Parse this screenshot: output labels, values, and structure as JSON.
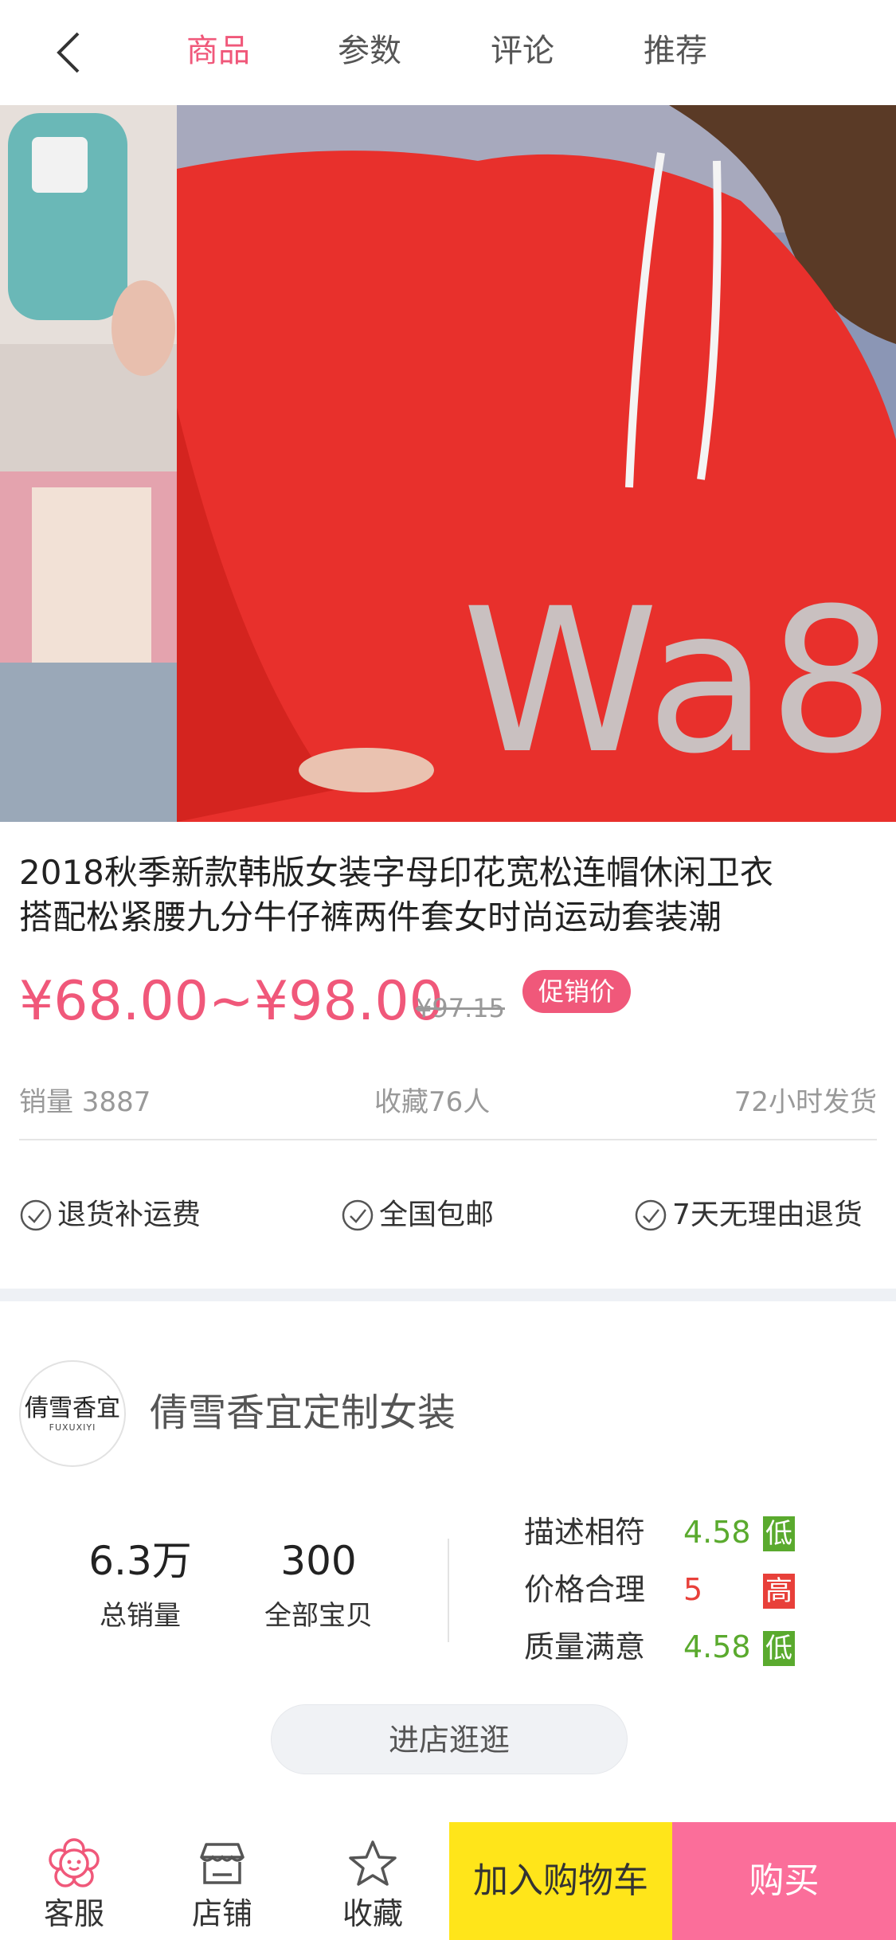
{
  "nav": {
    "tabs": [
      {
        "label": "商品",
        "active": true
      },
      {
        "label": "参数",
        "active": false
      },
      {
        "label": "评论",
        "active": false
      },
      {
        "label": "推荐",
        "active": false
      }
    ],
    "back_icon": "chevron-left-icon",
    "active_color": "#f0587a"
  },
  "hero": {
    "print_text": "Wa8"
  },
  "product": {
    "title_line1": "2018秋季新款韩版女装字母印花宽松连帽休闲卫衣",
    "title_line2": "搭配松紧腰九分牛仔裤两件套女时尚运动套装潮",
    "price": "¥68.00~¥98.00",
    "original_price": "¥97.15",
    "promo_badge": "促销价",
    "sales": "销量 3887",
    "favorites": "收藏76人",
    "shipping": "72小时发货"
  },
  "guarantees": [
    "退货补运费",
    "全国包邮",
    "7天无理由退货"
  ],
  "store": {
    "logo_text": "倩雪香宜",
    "logo_subtext": "FUXUXIYI",
    "name": "倩雪香宜定制女装",
    "total_sales": "6.3万",
    "total_sales_label": "总销量",
    "all_items": "300",
    "all_items_label": "全部宝贝",
    "ratings": [
      {
        "label": "描述相符",
        "value": "4.58",
        "badge": "低",
        "color": "#5aaa2e"
      },
      {
        "label": "价格合理",
        "value": "5",
        "badge": "高",
        "color": "#e8403a"
      },
      {
        "label": "质量满意",
        "value": "4.58",
        "badge": "低",
        "color": "#5aaa2e"
      }
    ],
    "enter_button": "进店逛逛"
  },
  "bottom_bar": {
    "service": {
      "label": "客服",
      "icon": "flower-service-icon"
    },
    "shop": {
      "label": "店铺",
      "icon": "storefront-icon"
    },
    "favorite": {
      "label": "收藏",
      "icon": "star-icon"
    },
    "add_to_cart": "加入购物车",
    "buy": "购买",
    "cart_color": "#ffe51a",
    "buy_color": "#fb6e9a"
  }
}
